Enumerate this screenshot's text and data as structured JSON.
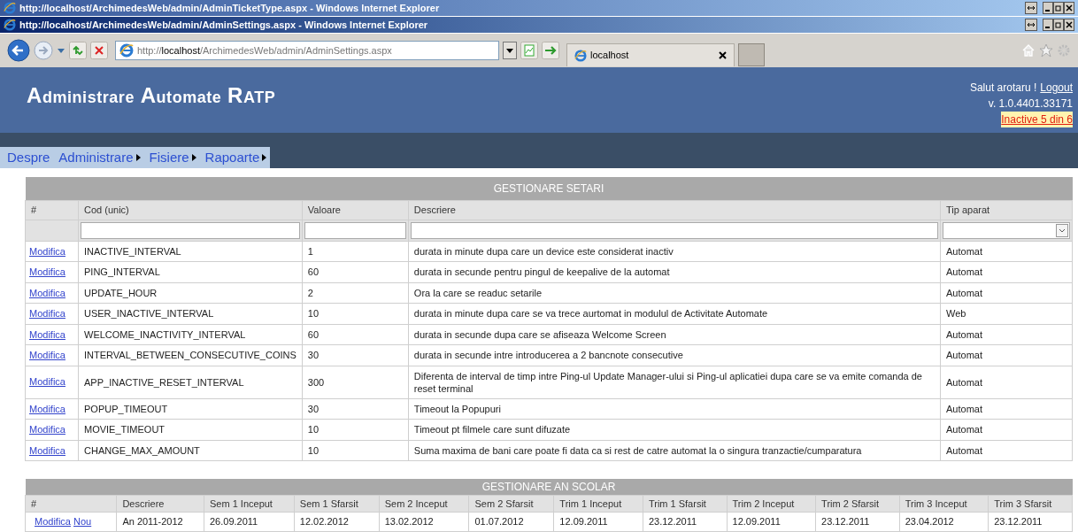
{
  "windows": [
    {
      "title": "http://localhost/ArchimedesWeb/admin/AdminTicketType.aspx - Windows Internet Explorer",
      "active": false
    },
    {
      "title": "http://localhost/ArchimedesWeb/admin/AdminSettings.aspx - Windows Internet Explorer",
      "active": true
    }
  ],
  "toolbar": {
    "address_parts": [
      {
        "text": "http://",
        "kind": "dim"
      },
      {
        "text": "localhost",
        "kind": "host"
      },
      {
        "text": "/ArchimedesWeb/admin/AdminSettings.aspx",
        "kind": "dim"
      }
    ],
    "tab": "localhost"
  },
  "header": {
    "title": "Administrare Automate RATP",
    "greeting": "Salut arotaru !",
    "logout": "Logout",
    "version": "v. 1.0.4401.33171",
    "alert": "Inactive 5 din 6"
  },
  "menu": [
    {
      "label": "Despre",
      "submenu": false
    },
    {
      "label": "Administrare",
      "submenu": true
    },
    {
      "label": "Fisiere",
      "submenu": true
    },
    {
      "label": "Rapoarte",
      "submenu": true
    }
  ],
  "settings": {
    "title": "GESTIONARE SETARI",
    "columns": [
      "#",
      "Cod (unic)",
      "Valoare",
      "Descriere",
      "Tip aparat"
    ],
    "rows": [
      {
        "action": "Modifica",
        "code": "INACTIVE_INTERVAL",
        "value": "1",
        "description": "durata in minute dupa care un device este considerat inactiv",
        "type": "Automat"
      },
      {
        "action": "Modifica",
        "code": "PING_INTERVAL",
        "value": "60",
        "description": "durata in secunde pentru pingul de keepalive de la automat",
        "type": "Automat"
      },
      {
        "action": "Modifica",
        "code": "UPDATE_HOUR",
        "value": "2",
        "description": "Ora la care se readuc setarile",
        "type": "Automat"
      },
      {
        "action": "Modifica",
        "code": "USER_INACTIVE_INTERVAL",
        "value": "10",
        "description": "durata in minute dupa care se va trece aurtomat in modulul de Activitate Automate",
        "type": "Web"
      },
      {
        "action": "Modifica",
        "code": "WELCOME_INACTIVITY_INTERVAL",
        "value": "60",
        "description": "durata in secunde dupa care se afiseaza Welcome Screen",
        "type": "Automat"
      },
      {
        "action": "Modifica",
        "code": "INTERVAL_BETWEEN_CONSECUTIVE_COINS",
        "value": "30",
        "description": "durata in secunde intre introducerea a 2 bancnote consecutive",
        "type": "Automat"
      },
      {
        "action": "Modifica",
        "code": "APP_INACTIVE_RESET_INTERVAL",
        "value": "300",
        "description": "Diferenta de interval de timp intre Ping-ul Update Manager-ului si Ping-ul aplicatiei dupa care se va emite comanda de reset terminal",
        "type": "Automat"
      },
      {
        "action": "Modifica",
        "code": "POPUP_TIMEOUT",
        "value": "30",
        "description": "Timeout la Popupuri",
        "type": "Automat"
      },
      {
        "action": "Modifica",
        "code": "MOVIE_TIMEOUT",
        "value": "10",
        "description": "Timeout pt filmele care sunt difuzate",
        "type": "Automat"
      },
      {
        "action": "Modifica",
        "code": "CHANGE_MAX_AMOUNT",
        "value": "10",
        "description": "Suma maxima de bani care poate fi data ca si rest de catre automat la o singura tranzactie/cumparatura",
        "type": "Automat"
      }
    ]
  },
  "school_year": {
    "title": "GESTIONARE AN SCOLAR",
    "columns": [
      "#",
      "Descriere",
      "Sem 1 Inceput",
      "Sem 1 Sfarsit",
      "Sem 2 Inceput",
      "Sem 2 Sfarsit",
      "Trim 1 Inceput",
      "Trim 1 Sfarsit",
      "Trim 2 Inceput",
      "Trim 2 Sfarsit",
      "Trim 3 Inceput",
      "Trim 3 Sfarsit"
    ],
    "rows": [
      {
        "cells": [
          [
            "Modifica",
            "Nou"
          ],
          "An 2011-2012",
          "26.09.2011",
          "12.02.2012",
          "13.02.2012",
          "01.07.2012",
          "12.09.2011",
          "23.12.2011",
          "12.09.2011",
          "23.12.2011",
          "23.04.2012",
          "23.12.2011"
        ]
      }
    ]
  }
}
